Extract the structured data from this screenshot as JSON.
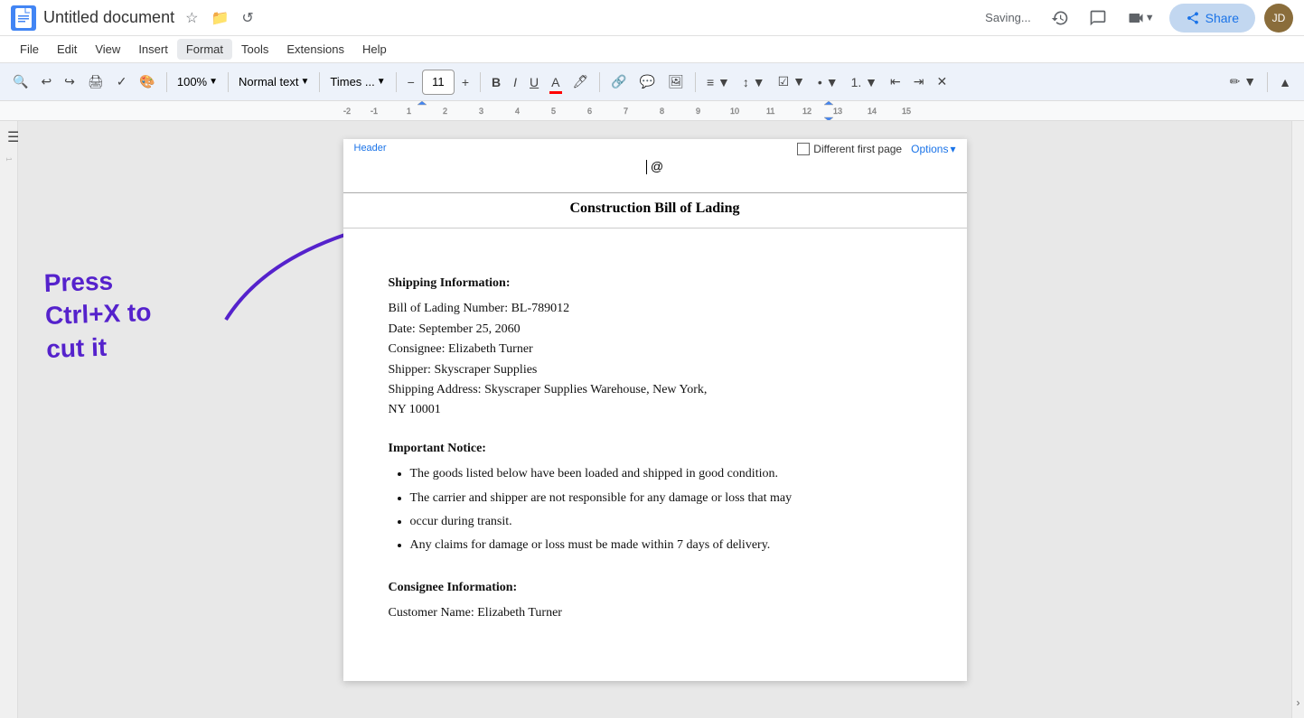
{
  "titleBar": {
    "title": "Untitled document",
    "saving": "Saving...",
    "shareLabel": "Share"
  },
  "menuBar": {
    "items": [
      "File",
      "Edit",
      "View",
      "Insert",
      "Format",
      "Tools",
      "Extensions",
      "Help"
    ]
  },
  "toolbar": {
    "zoom": "100%",
    "style": "Normal text",
    "font": "Times ...",
    "fontSize": "11",
    "boldLabel": "B",
    "italicLabel": "I",
    "underlineLabel": "U"
  },
  "header": {
    "label": "Header",
    "differentFirstPage": "Different first page",
    "optionsLabel": "Options",
    "cursorAt": "| @",
    "title": "Construction Bill of Lading"
  },
  "document": {
    "shippingTitle": "Shipping Information:",
    "shippingLines": [
      "Bill of Lading Number: BL-789012",
      "Date: September 25, 2060",
      "Consignee: Elizabeth Turner",
      "Shipper: Skyscraper Supplies",
      "Shipping Address: Skyscraper Supplies Warehouse, New York,",
      "NY 10001"
    ],
    "noticeTitle": "Important Notice:",
    "noticeItems": [
      "The goods listed below have been loaded and shipped in good condition.",
      "The carrier and shipper are not responsible for any damage or loss that may",
      "occur during transit.",
      "Any claims for damage or loss must be made within 7 days of delivery."
    ],
    "consigneeTitle": "Consignee Information:",
    "consigneeLine": "Customer Name: Elizabeth Turner"
  },
  "annotation": {
    "line1": "Press",
    "line2": "Ctrl+X  to",
    "line3": "cut it"
  }
}
